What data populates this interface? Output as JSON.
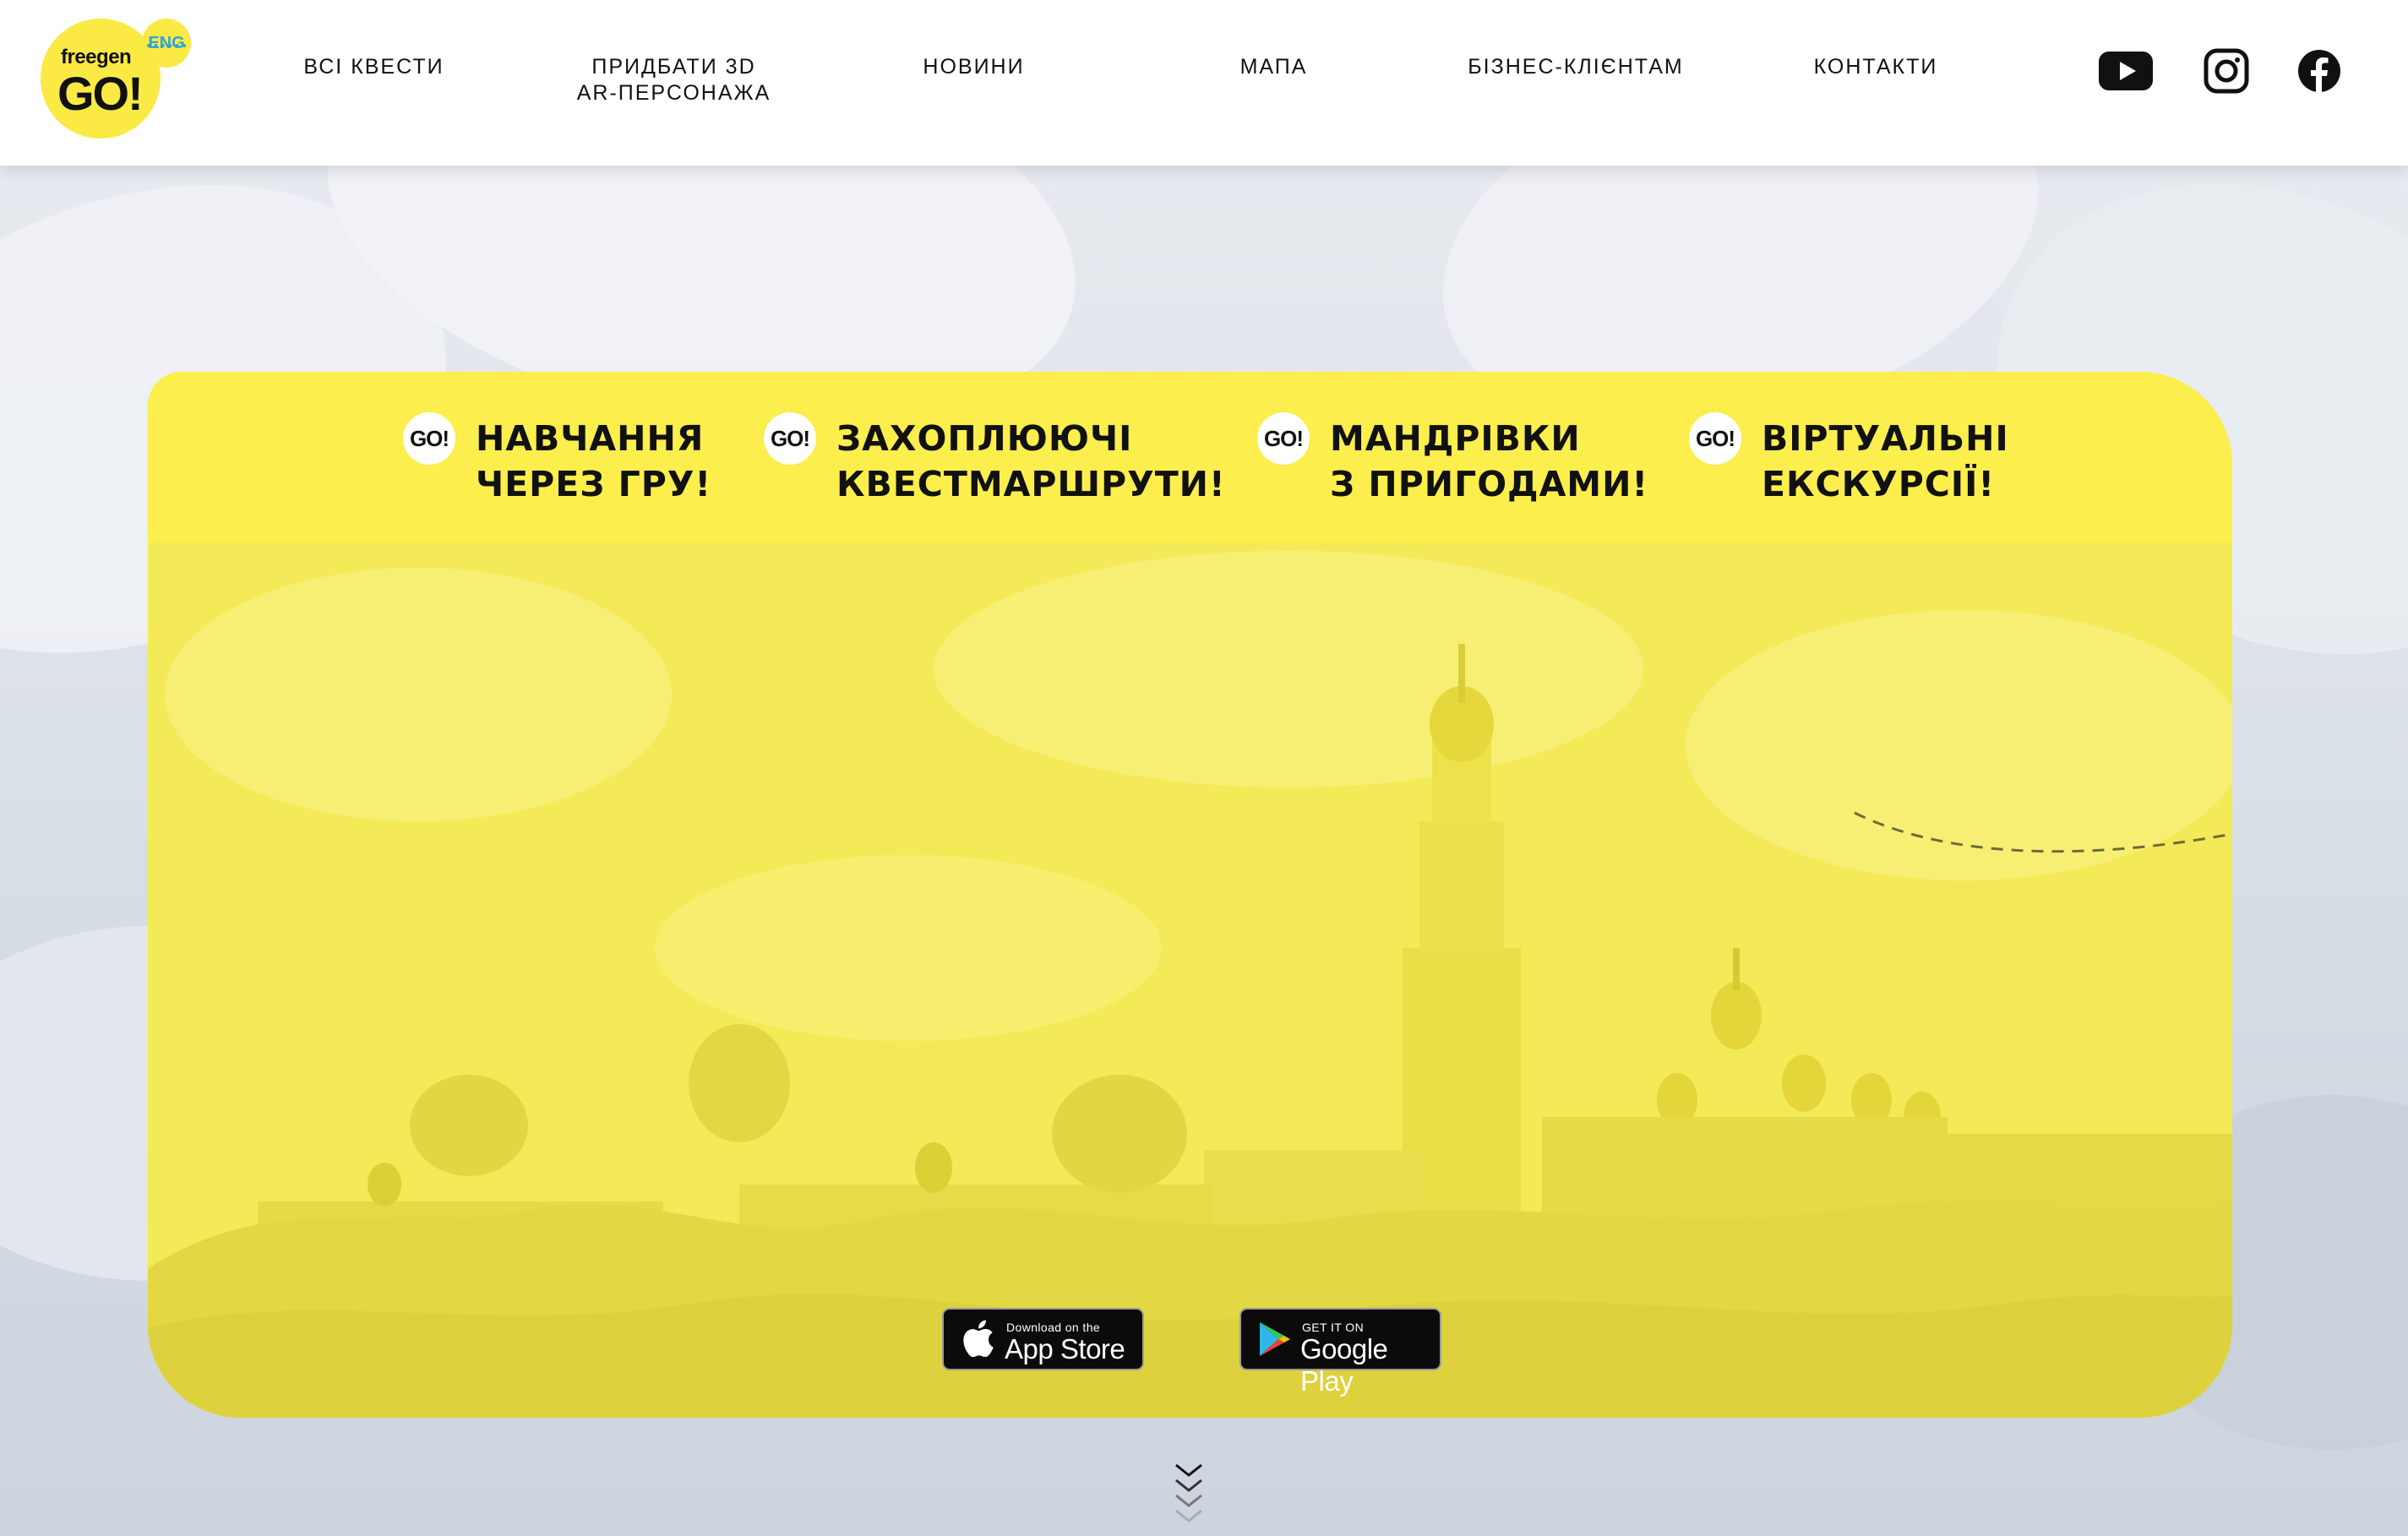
{
  "logo": {
    "small": "freegen",
    "big": "GO!",
    "lang": "ENG"
  },
  "nav": [
    {
      "label": "ВСІ КВЕСТИ"
    },
    {
      "label": "ПРИДБАТИ 3D\nAR-ПЕРСОНАЖА"
    },
    {
      "label": "НОВИНИ"
    },
    {
      "label": "МАПА"
    },
    {
      "label": "БІЗНЕС-КЛІЄНТАМ"
    },
    {
      "label": "КОНТАКТИ"
    }
  ],
  "social": [
    "youtube-icon",
    "instagram-icon",
    "facebook-icon"
  ],
  "features": [
    {
      "badge": "GO!",
      "text": "НАВЧАННЯ\nЧЕРЕЗ ГРУ!"
    },
    {
      "badge": "GO!",
      "text": "ЗАХОПЛЮЮЧІ\nКВЕСТМАРШРУТИ!"
    },
    {
      "badge": "GO!",
      "text": "МАНДРІВКИ\nЗ ПРИГОДАМИ!"
    },
    {
      "badge": "GO!",
      "text": "ВІРТУАЛЬНІ\nЕКСКУРСІЇ!"
    }
  ],
  "stores": {
    "appstore": {
      "small": "Download on the",
      "big": "App Store"
    },
    "googleplay": {
      "small": "GET IT ON",
      "big": "Google Play"
    }
  },
  "colors": {
    "brand_yellow": "#fcee4c",
    "accent_blue": "#2ea6d8",
    "text": "#111111"
  }
}
